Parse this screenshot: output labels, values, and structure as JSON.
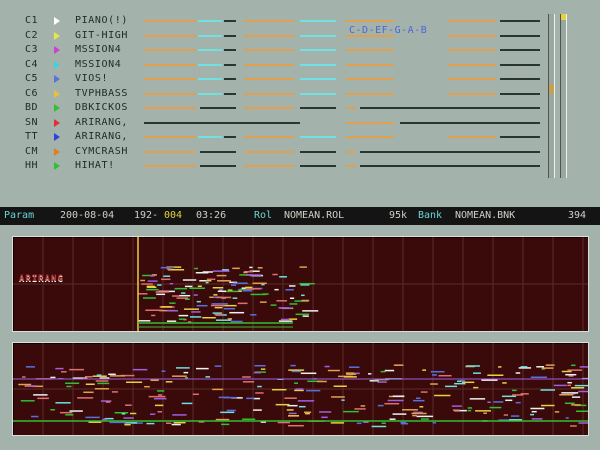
{
  "channels": [
    {
      "id": "C1",
      "name": "PIANO(!)",
      "arrow_color": "#ffffff"
    },
    {
      "id": "C2",
      "name": "GIT-HIGH",
      "arrow_color": "#e6e64a"
    },
    {
      "id": "C3",
      "name": "MSSION4",
      "arrow_color": "#d040d0"
    },
    {
      "id": "C4",
      "name": "MSSION4",
      "arrow_color": "#40d0e0"
    },
    {
      "id": "C5",
      "name": "VIOS!",
      "arrow_color": "#5a70e0"
    },
    {
      "id": "C6",
      "name": "TVPHBASS",
      "arrow_color": "#e8c040"
    },
    {
      "id": "BD",
      "name": "DBKICKOS",
      "arrow_color": "#30c030"
    },
    {
      "id": "SN",
      "name": "ARIRANG,",
      "arrow_color": "#e03030"
    },
    {
      "id": "TT",
      "name": "ARIRANG,",
      "arrow_color": "#3040e0"
    },
    {
      "id": "CM",
      "name": "CYMCRASH",
      "arrow_color": "#e08020"
    },
    {
      "id": "HH",
      "name": "HIHAT!",
      "arrow_color": "#30c030"
    }
  ],
  "note_sequence": "C-D-EF-G-A-B",
  "status": {
    "param_label": "Param",
    "date": "200-08-04",
    "counter_a": "192-",
    "counter_b": "004",
    "time": "03:26",
    "rol_label": "Rol",
    "rol_file": "NOMEAN.ROL",
    "size": "95k",
    "bank_label": "Bank",
    "bank_file": "NOMEAN.BNK",
    "right_value": "394"
  },
  "mini_logo": "ARIRANG",
  "colors": {
    "background": "#a3b3ab",
    "panel": "#3a0a0a",
    "track_orange": "#e0a050",
    "track_cyan": "#70e0e0",
    "track_dark": "#2a3530"
  }
}
